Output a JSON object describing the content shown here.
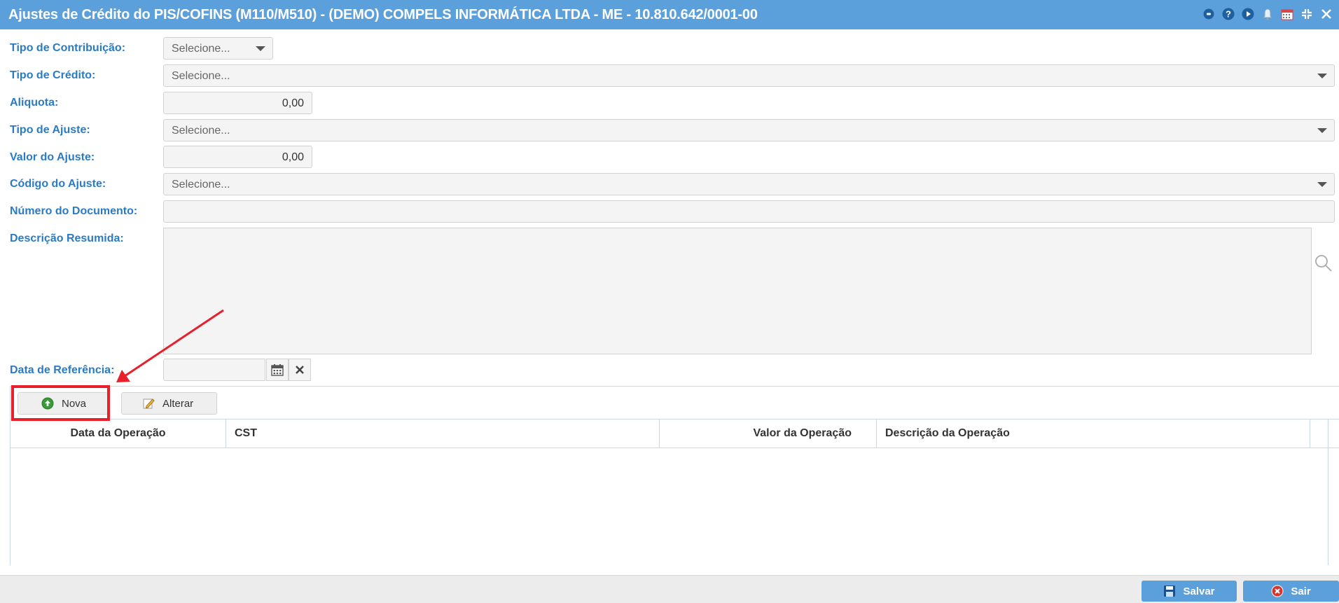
{
  "window": {
    "title": "Ajustes de Crédito do PIS/COFINS (M110/M510) - (DEMO) COMPELS INFORMÁTICA LTDA - ME - 10.810.642/0001-00",
    "tools": [
      "info-icon",
      "help-icon",
      "play-icon",
      "bell-icon",
      "calendar-icon",
      "compress-icon",
      "close-icon"
    ]
  },
  "form": {
    "tipo_contribuicao": {
      "label": "Tipo de Contribuição:",
      "value": "Selecione..."
    },
    "tipo_credito": {
      "label": "Tipo de Crédito:",
      "value": "Selecione..."
    },
    "aliquota": {
      "label": "Aliquota:",
      "value": "0,00"
    },
    "tipo_ajuste": {
      "label": "Tipo de Ajuste:",
      "value": "Selecione..."
    },
    "valor_ajuste": {
      "label": "Valor do Ajuste:",
      "value": "0,00"
    },
    "codigo_ajuste": {
      "label": "Código do Ajuste:",
      "value": "Selecione..."
    },
    "numero_documento": {
      "label": "Número do Documento:",
      "value": ""
    },
    "descricao_resumida": {
      "label": "Descrição Resumida:",
      "value": ""
    },
    "data_referencia": {
      "label": "Data de Referência:",
      "value": ""
    }
  },
  "grid": {
    "toolbar": {
      "nova_label": "Nova",
      "alterar_label": "Alterar"
    },
    "columns": [
      "Data da Operação",
      "CST",
      "Valor da Operação",
      "Descrição da Operação"
    ],
    "rows": []
  },
  "footer": {
    "salvar_label": "Salvar",
    "sair_label": "Sair"
  },
  "colors": {
    "accent": "#5b9fdb",
    "label": "#2b7bc4",
    "highlight": "#e8202a"
  }
}
